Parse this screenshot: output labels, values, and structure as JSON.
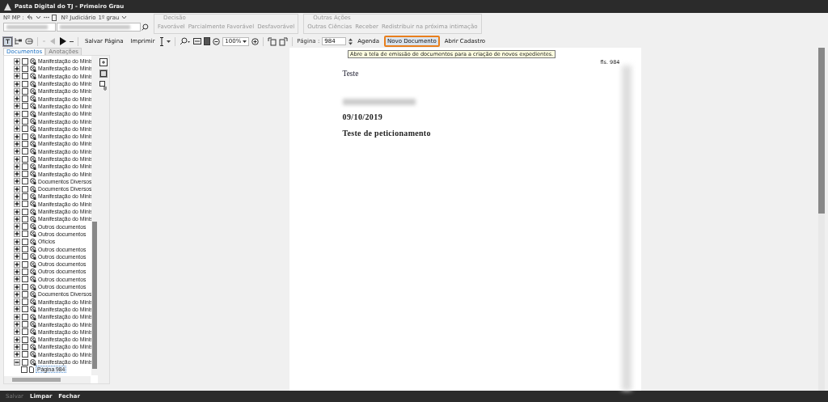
{
  "window": {
    "title": "Pasta Digital do TJ - Primeiro Grau"
  },
  "header": {
    "mp_label": "Nº MP :",
    "judicial_label": "Nº Judiciário",
    "instance": "1º grau",
    "groups": [
      {
        "title": "Decisão",
        "buttons": [
          {
            "label": "Favorável",
            "disabled": true
          },
          {
            "label": "Parcialmente Favorável",
            "disabled": true
          },
          {
            "label": "Desfavorável",
            "disabled": true
          }
        ]
      },
      {
        "title": "Outras Ações",
        "buttons": [
          {
            "label": "Outras Ciências",
            "disabled": true
          },
          {
            "label": "Receber",
            "disabled": true
          },
          {
            "label": "Redistribuir na próxima intimação",
            "disabled": true
          }
        ]
      }
    ]
  },
  "toolbar": {
    "save_page": "Salvar Página",
    "print": "Imprimir",
    "zoom": "100%",
    "page_label": "Página :",
    "page": "984",
    "actions": [
      {
        "label": "Agenda",
        "highlighted": false
      },
      {
        "label": "Novo Documento",
        "highlighted": true
      },
      {
        "label": "Abrir Cadastro",
        "highlighted": false
      }
    ],
    "tooltip": "Abre a tela de emissão de documentos para a criação de novos expedientes."
  },
  "tabs": [
    {
      "label": "Documentos",
      "selected": true
    },
    {
      "label": "Anotações",
      "selected": false
    }
  ],
  "tree": [
    {
      "label": "Manifestação do Minis",
      "checked": false,
      "expanded": false
    },
    {
      "label": "Manifestação do Minis",
      "checked": false,
      "expanded": false
    },
    {
      "label": "Manifestação do Minis",
      "checked": false,
      "expanded": false
    },
    {
      "label": "Manifestação do Minis",
      "checked": false,
      "expanded": false
    },
    {
      "label": "Manifestação do Minis",
      "checked": false,
      "expanded": false
    },
    {
      "label": "Manifestação do Minis",
      "checked": false,
      "expanded": false
    },
    {
      "label": "Manifestação do Minis",
      "checked": false,
      "expanded": false
    },
    {
      "label": "Manifestação do Minis",
      "checked": false,
      "expanded": false
    },
    {
      "label": "Manifestação do Minis",
      "checked": false,
      "expanded": false
    },
    {
      "label": "Manifestação do Minis",
      "checked": false,
      "expanded": false
    },
    {
      "label": "Manifestação do Minis",
      "checked": false,
      "expanded": false
    },
    {
      "label": "Manifestação do Minis",
      "checked": false,
      "expanded": false
    },
    {
      "label": "Manifestação do Minis",
      "checked": false,
      "expanded": false
    },
    {
      "label": "Manifestação do Minis",
      "checked": false,
      "expanded": false
    },
    {
      "label": "Manifestação do Minis",
      "checked": false,
      "expanded": false
    },
    {
      "label": "Manifestação do Minis",
      "checked": false,
      "expanded": false
    },
    {
      "label": "Documentos Diversos",
      "checked": false,
      "expanded": false
    },
    {
      "label": "Documentos Diversos",
      "checked": false,
      "expanded": false
    },
    {
      "label": "Manifestação do Minis",
      "checked": false,
      "expanded": false
    },
    {
      "label": "Manifestação do Minis",
      "checked": false,
      "expanded": false
    },
    {
      "label": "Manifestação do Minis",
      "checked": false,
      "expanded": false
    },
    {
      "label": "Manifestação do Minis",
      "checked": false,
      "expanded": false
    },
    {
      "label": "Outros documentos",
      "checked": false,
      "expanded": false
    },
    {
      "label": "Outros documentos",
      "checked": false,
      "expanded": false
    },
    {
      "label": "Ofícios",
      "checked": false,
      "expanded": false
    },
    {
      "label": "Outros documentos",
      "checked": false,
      "expanded": false
    },
    {
      "label": "Outros documentos",
      "checked": false,
      "expanded": false
    },
    {
      "label": "Outros documentos",
      "checked": false,
      "expanded": false
    },
    {
      "label": "Outros documentos",
      "checked": false,
      "expanded": false
    },
    {
      "label": "Outros documentos",
      "checked": false,
      "expanded": false
    },
    {
      "label": "Outros documentos",
      "checked": false,
      "expanded": false
    },
    {
      "label": "Documentos Diversos",
      "checked": false,
      "expanded": false
    },
    {
      "label": "Manifestação do Minis",
      "checked": false,
      "expanded": false
    },
    {
      "label": "Manifestação do Minis",
      "checked": false,
      "expanded": false
    },
    {
      "label": "Manifestação do Minis",
      "checked": false,
      "expanded": false
    },
    {
      "label": "Manifestação do Minis",
      "checked": false,
      "expanded": false
    },
    {
      "label": "Manifestação do Minis",
      "checked": false,
      "expanded": false
    },
    {
      "label": "Manifestação do Minis",
      "checked": false,
      "expanded": false
    },
    {
      "label": "Manifestação do Minis",
      "checked": false,
      "expanded": false
    },
    {
      "label": "Manifestação do Minis",
      "checked": false,
      "expanded": false
    },
    {
      "label": "Manifestação do Minis",
      "checked": false,
      "expanded": true,
      "children": [
        {
          "label": "Página 984",
          "checked": false,
          "selected": true
        }
      ]
    }
  ],
  "document": {
    "folio": "fls. 984",
    "heading": "Teste",
    "date": "09/10/2019",
    "subject": "Teste de peticionamento"
  },
  "footer": [
    {
      "label": "Salvar",
      "disabled": true
    },
    {
      "label": "Limpar",
      "disabled": false
    },
    {
      "label": "Fechar",
      "disabled": false
    }
  ]
}
